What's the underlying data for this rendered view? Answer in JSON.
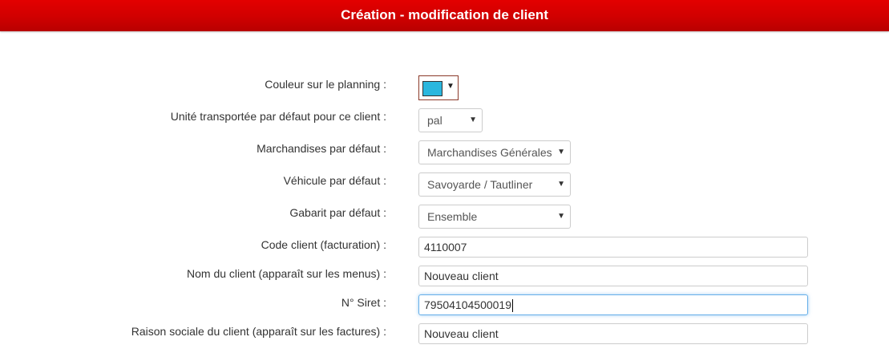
{
  "header": {
    "title": "Création - modification de client",
    "color": "#d00000"
  },
  "form": {
    "planning_color": {
      "label": "Couleur sur le planning :",
      "value": "#2ab7de",
      "icon": "dropdown-triangle"
    },
    "default_unit": {
      "label": "Unité transportée par défaut pour ce client :",
      "value": "pal"
    },
    "default_goods": {
      "label": "Marchandises par défaut :",
      "value": "Marchandises Générales"
    },
    "default_vehicle": {
      "label": "Véhicule par défaut :",
      "value": "Savoyarde / Tautliner"
    },
    "default_gauge": {
      "label": "Gabarit par défaut :",
      "value": "Ensemble"
    },
    "client_code": {
      "label": "Code client (facturation) :",
      "value": "4110007"
    },
    "client_name": {
      "label": "Nom du client (apparaît sur les menus) :",
      "value": "Nouveau client"
    },
    "siret": {
      "label": "N° Siret :",
      "value": "79504104500019"
    },
    "company_name": {
      "label": "Raison sociale du client (apparaît sur les factures) :",
      "value": "Nouveau client"
    }
  }
}
